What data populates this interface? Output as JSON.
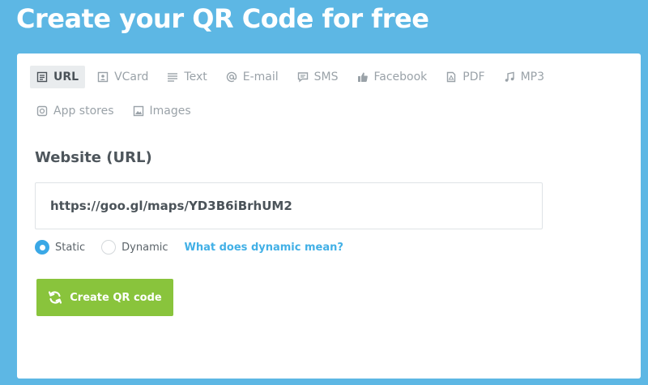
{
  "header": {
    "title": "Create your QR Code for free"
  },
  "tabs": {
    "row1": [
      {
        "label": "URL",
        "icon": "document-icon",
        "active": true
      },
      {
        "label": "VCard",
        "icon": "contact-card-icon"
      },
      {
        "label": "Text",
        "icon": "text-lines-icon"
      },
      {
        "label": "E-mail",
        "icon": "at-sign-icon"
      },
      {
        "label": "SMS",
        "icon": "chat-bubble-icon"
      },
      {
        "label": "Facebook",
        "icon": "thumbs-up-icon"
      },
      {
        "label": "PDF",
        "icon": "pdf-file-icon"
      },
      {
        "label": "MP3",
        "icon": "music-note-icon"
      }
    ],
    "row2": [
      {
        "label": "App stores",
        "icon": "app-store-icon"
      },
      {
        "label": "Images",
        "icon": "image-icon"
      }
    ]
  },
  "form": {
    "field_label": "Website (URL)",
    "url_value": "https://goo.gl/maps/YD3B6iBrhUM2",
    "radio_static": "Static",
    "radio_dynamic": "Dynamic",
    "selected_mode": "Static",
    "help_link": "What does dynamic mean?",
    "create_button": "Create QR code"
  },
  "colors": {
    "background": "#5db7e4",
    "button": "#89c43c",
    "accent_blue": "#3aa8e6",
    "link": "#42b0e6"
  }
}
